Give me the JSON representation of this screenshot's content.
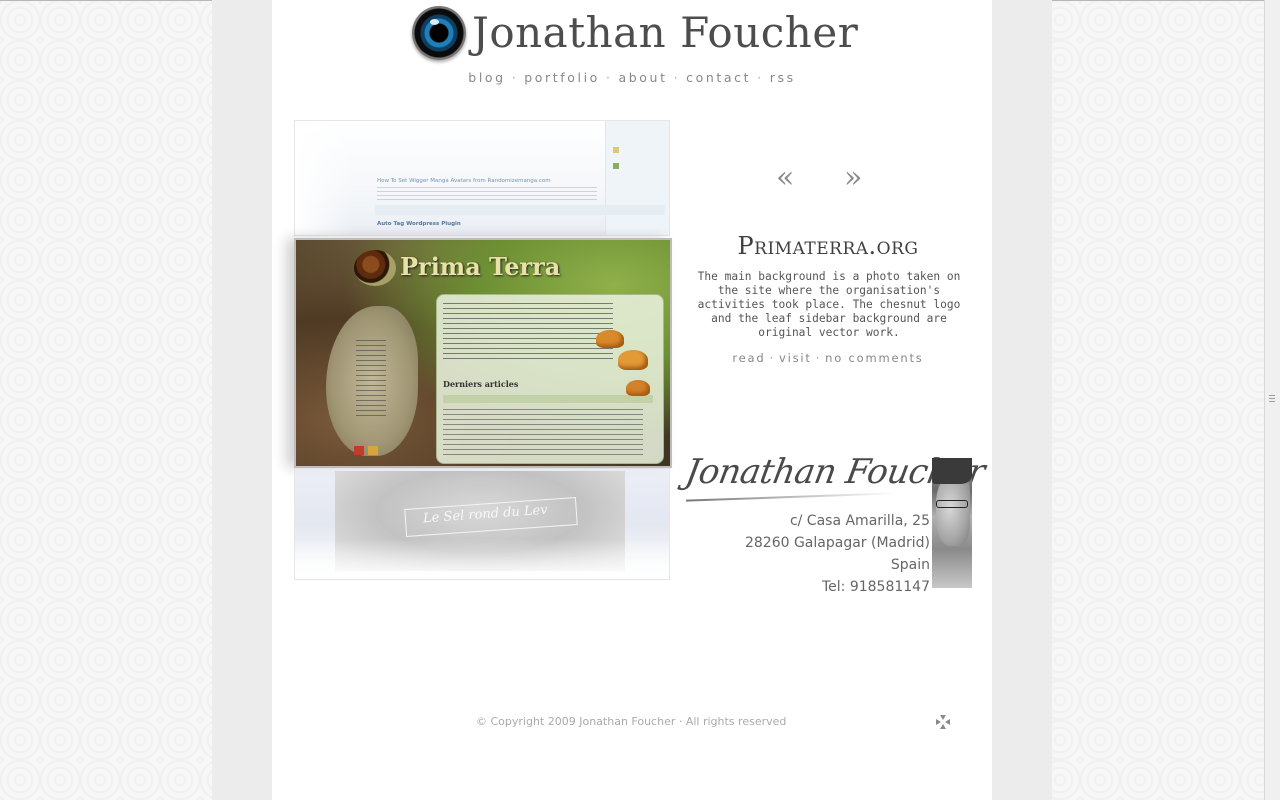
{
  "header": {
    "title": "Jonathan Foucher",
    "logo_icon": "camera-lens-icon"
  },
  "nav": {
    "items": [
      {
        "label": "blog"
      },
      {
        "label": "portfolio"
      },
      {
        "label": "about"
      },
      {
        "label": "contact"
      },
      {
        "label": "rss"
      }
    ],
    "separator": "·"
  },
  "portfolio": {
    "thumbnails": [
      {
        "caption_title": "How To Set Wigger Manga Avatars from Randomizemanga.com",
        "caption_link": "Auto Tag Wordpress Plugin"
      },
      {
        "brand": "Prima Terra",
        "heading": "Derniers articles"
      },
      {
        "banner": "Le Sel rond du Lev"
      }
    ],
    "prev_label": "«",
    "next_label": "»",
    "current": {
      "title": "Primaterra.org",
      "description": "The main background is a photo taken on the site where the organisation's activities took place. The chesnut logo and the leaf sidebar background are original vector work.",
      "links": [
        {
          "label": "read"
        },
        {
          "label": "visit"
        },
        {
          "label": "no comments"
        }
      ]
    }
  },
  "contact": {
    "signature": "Jonathan Foucher",
    "address": [
      "c/ Casa Amarilla, 25",
      "28260 Galapagar (Madrid)",
      "Spain",
      "Tel: 918581147"
    ]
  },
  "footer": {
    "copyright": "© Copyright 2009 Jonathan Foucher · All rights reserved",
    "icon": "move-arrows-icon"
  },
  "colors": {
    "page_bg": "#ffffff",
    "band_bg": "#ececec",
    "text": "#4d4d4d",
    "muted": "#888888"
  }
}
